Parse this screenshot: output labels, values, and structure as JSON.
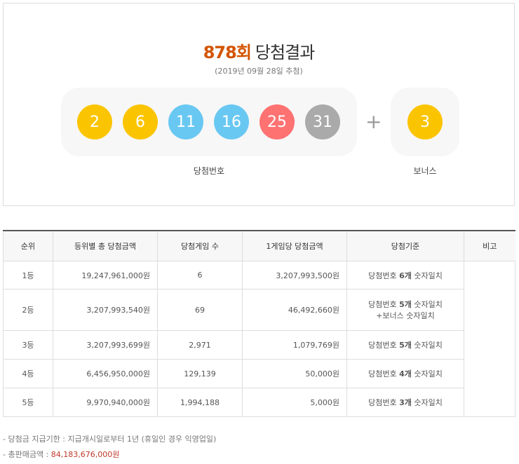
{
  "header": {
    "round": "878회",
    "title_rest": "당첨결과",
    "date": "(2019년 09월 28일 추첨)"
  },
  "balls": {
    "winning": [
      {
        "num": "2",
        "color": "#fbc400"
      },
      {
        "num": "6",
        "color": "#fbc400"
      },
      {
        "num": "11",
        "color": "#69c8f2"
      },
      {
        "num": "16",
        "color": "#69c8f2"
      },
      {
        "num": "25",
        "color": "#ff7272"
      },
      {
        "num": "31",
        "color": "#aaaaaa"
      }
    ],
    "plus": "+",
    "bonus": {
      "num": "3",
      "color": "#fbc400"
    },
    "winning_label": "당첨번호",
    "bonus_label": "보너스"
  },
  "table": {
    "headers": [
      "순위",
      "등위별 총 당첨금액",
      "당첨게임 수",
      "1게임당 당첨금액",
      "당첨기준",
      "비고"
    ],
    "rows": [
      {
        "rank": "1등",
        "total": "19,247,961,000원",
        "count": "6",
        "per": "3,207,993,500원",
        "crit_pre": "당첨번호 ",
        "crit_num": "6개",
        "crit_post": " 숫자일치",
        "crit2": ""
      },
      {
        "rank": "2등",
        "total": "3,207,993,540원",
        "count": "69",
        "per": "46,492,660원",
        "crit_pre": "당첨번호 ",
        "crit_num": "5개",
        "crit_post": " 숫자일치",
        "crit2": "+보너스 숫자일치"
      },
      {
        "rank": "3등",
        "total": "3,207,993,699원",
        "count": "2,971",
        "per": "1,079,769원",
        "crit_pre": "당첨번호 ",
        "crit_num": "5개",
        "crit_post": " 숫자일치",
        "crit2": ""
      },
      {
        "rank": "4등",
        "total": "6,456,950,000원",
        "count": "129,139",
        "per": "50,000원",
        "crit_pre": "당첨번호 ",
        "crit_num": "4개",
        "crit_post": " 숫자일치",
        "crit2": ""
      },
      {
        "rank": "5등",
        "total": "9,970,940,000원",
        "count": "1,994,188",
        "per": "5,000원",
        "crit_pre": "당첨번호 ",
        "crit_num": "3개",
        "crit_post": " 숫자일치",
        "crit2": ""
      }
    ]
  },
  "footer": {
    "note1": "당첨금 지급기한 : 지급개시일로부터 1년 (휴일인 경우 익영업일)",
    "note2_label": "총판매금액 : ",
    "note2_value": "84,183,676,000원"
  }
}
